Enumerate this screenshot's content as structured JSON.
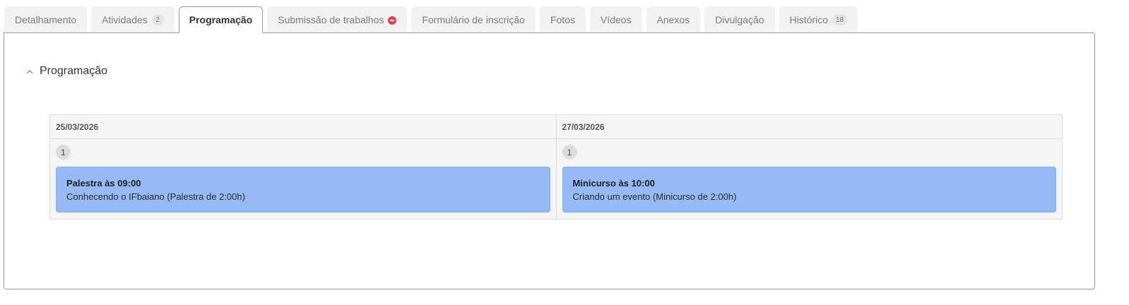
{
  "tabs": [
    {
      "label": "Detalhamento",
      "badge": null
    },
    {
      "label": "Atividades",
      "badge": "2"
    },
    {
      "label": "Programação",
      "badge": null
    },
    {
      "label": "Submissão de trabalhos",
      "badge": null,
      "icon": "blocked-icon"
    },
    {
      "label": "Formulário de inscrição",
      "badge": null
    },
    {
      "label": "Fotos",
      "badge": null
    },
    {
      "label": "Vídeos",
      "badge": null
    },
    {
      "label": "Anexos",
      "badge": null
    },
    {
      "label": "Divulgação",
      "badge": null
    },
    {
      "label": "Histórico",
      "badge": "18"
    }
  ],
  "active_tab": "Programação",
  "section": {
    "title": "Programação",
    "icon": "chevron-up-icon"
  },
  "schedule": {
    "days": [
      {
        "date": "25/03/2026",
        "count": "1",
        "events": [
          {
            "title": "Palestra às 09:00",
            "description": "Conhecendo o IFbaiano (Palestra de 2:00h)"
          }
        ]
      },
      {
        "date": "27/03/2026",
        "count": "1",
        "events": [
          {
            "title": "Minicurso às 10:00",
            "description": "Criando um evento (Minicurso de 2:00h)"
          }
        ]
      }
    ]
  },
  "colors": {
    "event_bg": "#95baf5",
    "blocked_icon": "#e0404f",
    "panel_border": "#9a9a9a"
  }
}
